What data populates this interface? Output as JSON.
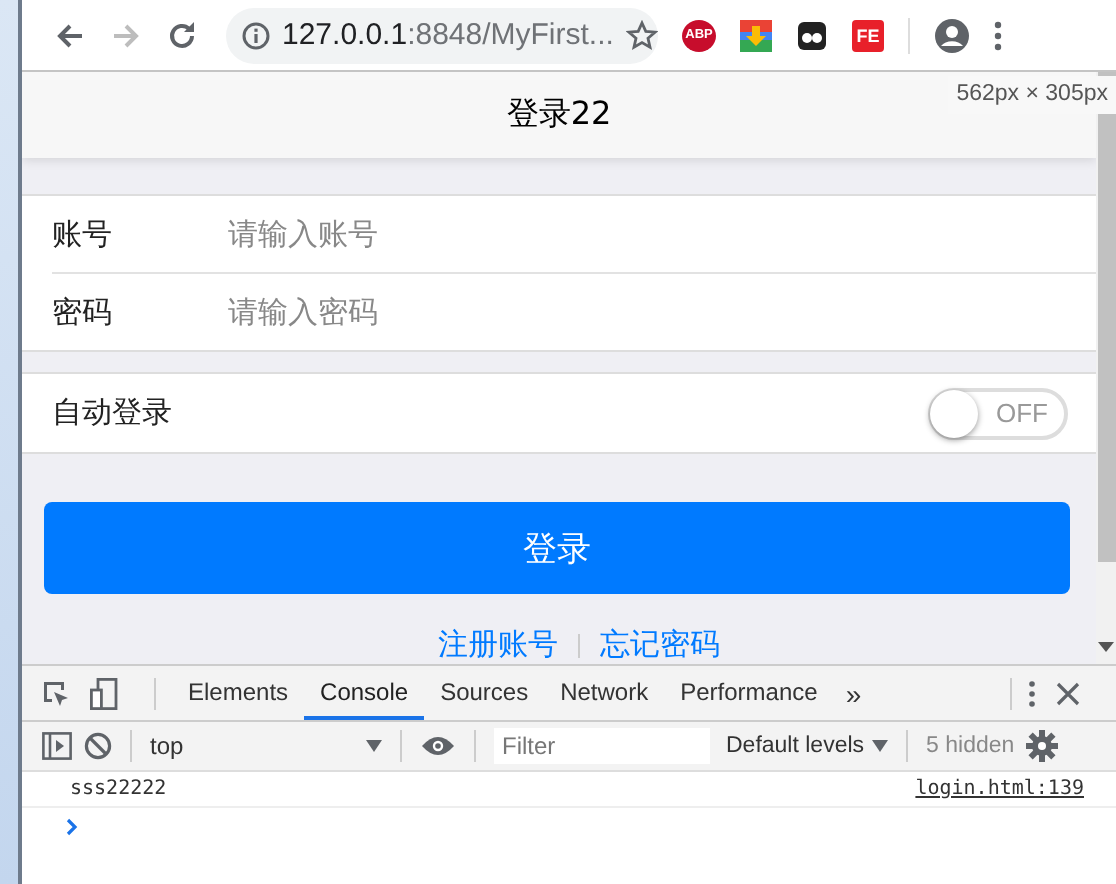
{
  "browser": {
    "url_host": "127.0.0.1",
    "url_rest": ":8848/MyFirst...",
    "extensions": [
      {
        "kind": "abp",
        "label": "ABP"
      },
      {
        "kind": "download"
      },
      {
        "kind": "glasses"
      },
      {
        "kind": "fe",
        "label": "FE"
      }
    ]
  },
  "viewport_size": "562px × 305px",
  "navbar": {
    "title": "登录22"
  },
  "fields": [
    {
      "label": "账号",
      "placeholder": "请输入账号"
    },
    {
      "label": "密码",
      "placeholder": "请输入密码"
    }
  ],
  "auto_login": {
    "label": "自动登录",
    "on": false,
    "state_text": "OFF"
  },
  "login_button": "登录",
  "links": [
    "注册账号",
    "忘记密码"
  ],
  "devtools": {
    "tabs": [
      {
        "label": "Elements",
        "selected": false
      },
      {
        "label": "Console",
        "selected": true
      },
      {
        "label": "Sources",
        "selected": false
      },
      {
        "label": "Network",
        "selected": false
      },
      {
        "label": "Performance",
        "selected": false
      }
    ],
    "more": "»",
    "context": "top",
    "filter_placeholder": "Filter",
    "levels": "Default levels",
    "hidden": "5 hidden",
    "logs": [
      {
        "message": "sss22222",
        "source": "login.html:139"
      }
    ]
  }
}
